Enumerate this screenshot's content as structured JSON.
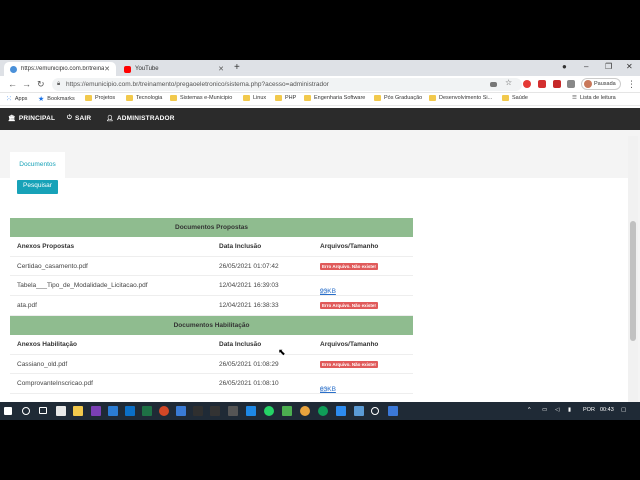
{
  "browser": {
    "tabs": [
      {
        "title": "https://emunicipio.com.br/treina",
        "favicon_color": "#4a90d9"
      },
      {
        "title": "YouTube",
        "favicon_color": "#ff0000"
      }
    ],
    "new_tab_label": "+",
    "url": "https://emunicipio.com.br/treinamento/pregaoeletronico/sistema.php?acesso=administrador",
    "profile_label": "Pausada",
    "bookmarks": [
      {
        "label": "Apps",
        "icon": "apps-grid-icon"
      },
      {
        "label": "Bookmarks",
        "icon": "star-icon"
      },
      {
        "label": "Projetos",
        "icon": "folder-icon"
      },
      {
        "label": "Tecnologia",
        "icon": "folder-icon"
      },
      {
        "label": "Sistemas e-Municipio",
        "icon": "folder-icon"
      },
      {
        "label": "Linux",
        "icon": "folder-icon"
      },
      {
        "label": "PHP",
        "icon": "folder-icon"
      },
      {
        "label": "Engenharia Software",
        "icon": "folder-icon"
      },
      {
        "label": "Pós Graduação",
        "icon": "folder-icon"
      },
      {
        "label": "Desenvolvimento Si...",
        "icon": "folder-icon"
      },
      {
        "label": "Saúde",
        "icon": "folder-icon"
      }
    ],
    "reading_list": "Lista de leitura"
  },
  "nav": {
    "items": [
      {
        "label": "PRINCIPAL",
        "icon": "bank-icon"
      },
      {
        "label": "SAIR",
        "icon": "power-icon"
      },
      {
        "label": "ADMINISTRADOR",
        "icon": "user-icon"
      }
    ]
  },
  "content": {
    "tab_label": "Documentos",
    "search_button": "Pesquisar"
  },
  "sections": [
    {
      "title": "Documentos Propostas",
      "headers": [
        "Anexos Propostas",
        "Data Inclusão",
        "Arquivos/Tamanho"
      ],
      "rows": [
        {
          "name": "Certidao_casamento.pdf",
          "date": "26/05/2021 01:07:42",
          "status": "error",
          "file": "Erro Arquivo. Não existe!"
        },
        {
          "name": "Tabela___Tipo_de_Modalidade_Licitacao.pdf",
          "date": "12/04/2021 16:39:03",
          "status": "ok",
          "file": "93KB"
        },
        {
          "name": "ata.pdf",
          "date": "12/04/2021 16:38:33",
          "status": "error",
          "file": "Erro Arquivo. Não existe!"
        }
      ]
    },
    {
      "title": "Documentos Habilitação",
      "headers": [
        "Anexos Habilitação",
        "Data Inclusão",
        "Arquivos/Tamanho"
      ],
      "rows": [
        {
          "name": "Cassiano_old.pdf",
          "date": "26/05/2021 01:08:29",
          "status": "error",
          "file": "Erro Arquivo. Não existe!"
        },
        {
          "name": "ComprovanteInscricao.pdf",
          "date": "26/05/2021 01:08:10",
          "status": "ok",
          "file": "63KB"
        }
      ]
    }
  ],
  "taskbar": {
    "lang": "POR",
    "time": "00:43"
  },
  "colors": {
    "accent": "#17a2b8",
    "section_header": "#8fbc8f",
    "nav_bg": "#2b2b2b",
    "error_badge": "#e05a5a"
  }
}
